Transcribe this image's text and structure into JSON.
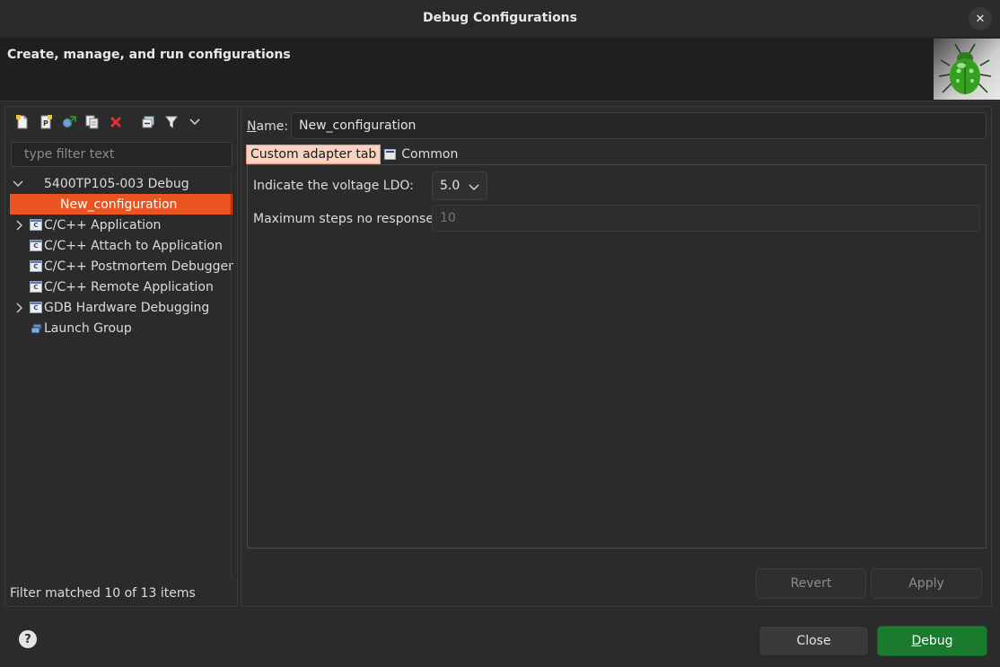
{
  "window": {
    "title": "Debug Configurations",
    "close_glyph": "✕"
  },
  "header": {
    "subtitle": "Create, manage, and run configurations",
    "banner_icon": "bug-icon"
  },
  "toolbar": {
    "icons": [
      "new-configuration-icon",
      "new-prototype-icon",
      "export-icon",
      "duplicate-icon",
      "delete-icon",
      "collapse-all-icon",
      "filter-icon",
      "view-menu-icon"
    ]
  },
  "filter": {
    "placeholder": "type filter text"
  },
  "tree": {
    "items": [
      {
        "label": "5400TP105-003 Debug",
        "expanded": true
      },
      {
        "label": "New_configuration",
        "selected": true
      },
      {
        "label": "C/C++ Application",
        "expandable": true
      },
      {
        "label": "C/C++ Attach to Application"
      },
      {
        "label": "C/C++ Postmortem Debugger"
      },
      {
        "label": "C/C++ Remote Application"
      },
      {
        "label": "GDB Hardware Debugging",
        "expandable": true
      },
      {
        "label": "Launch Group"
      }
    ],
    "icon_letter": "C"
  },
  "status": {
    "text": "Filter matched 10 of 13 items"
  },
  "config": {
    "name_label_mnemonic": "N",
    "name_label_rest": "ame:",
    "name_value": "New_configuration",
    "tabs": [
      {
        "label": "Custom adapter tab",
        "active": true
      },
      {
        "label": "Common",
        "active": false
      }
    ],
    "ldo_label": "Indicate the voltage LDO:",
    "ldo_value": "5.0",
    "steps_label": "Maximum steps no response:",
    "steps_placeholder": "10"
  },
  "buttons": {
    "revert": "Revert",
    "apply": "Apply",
    "close": "Close",
    "debug_mnemonic": "D",
    "debug_rest": "ebug",
    "help": "?"
  },
  "colors": {
    "accent": "#e95420",
    "tab_active_bg": "#f9d2c1",
    "primary_button": "#1a7a2e",
    "background": "#2b2b2b"
  }
}
